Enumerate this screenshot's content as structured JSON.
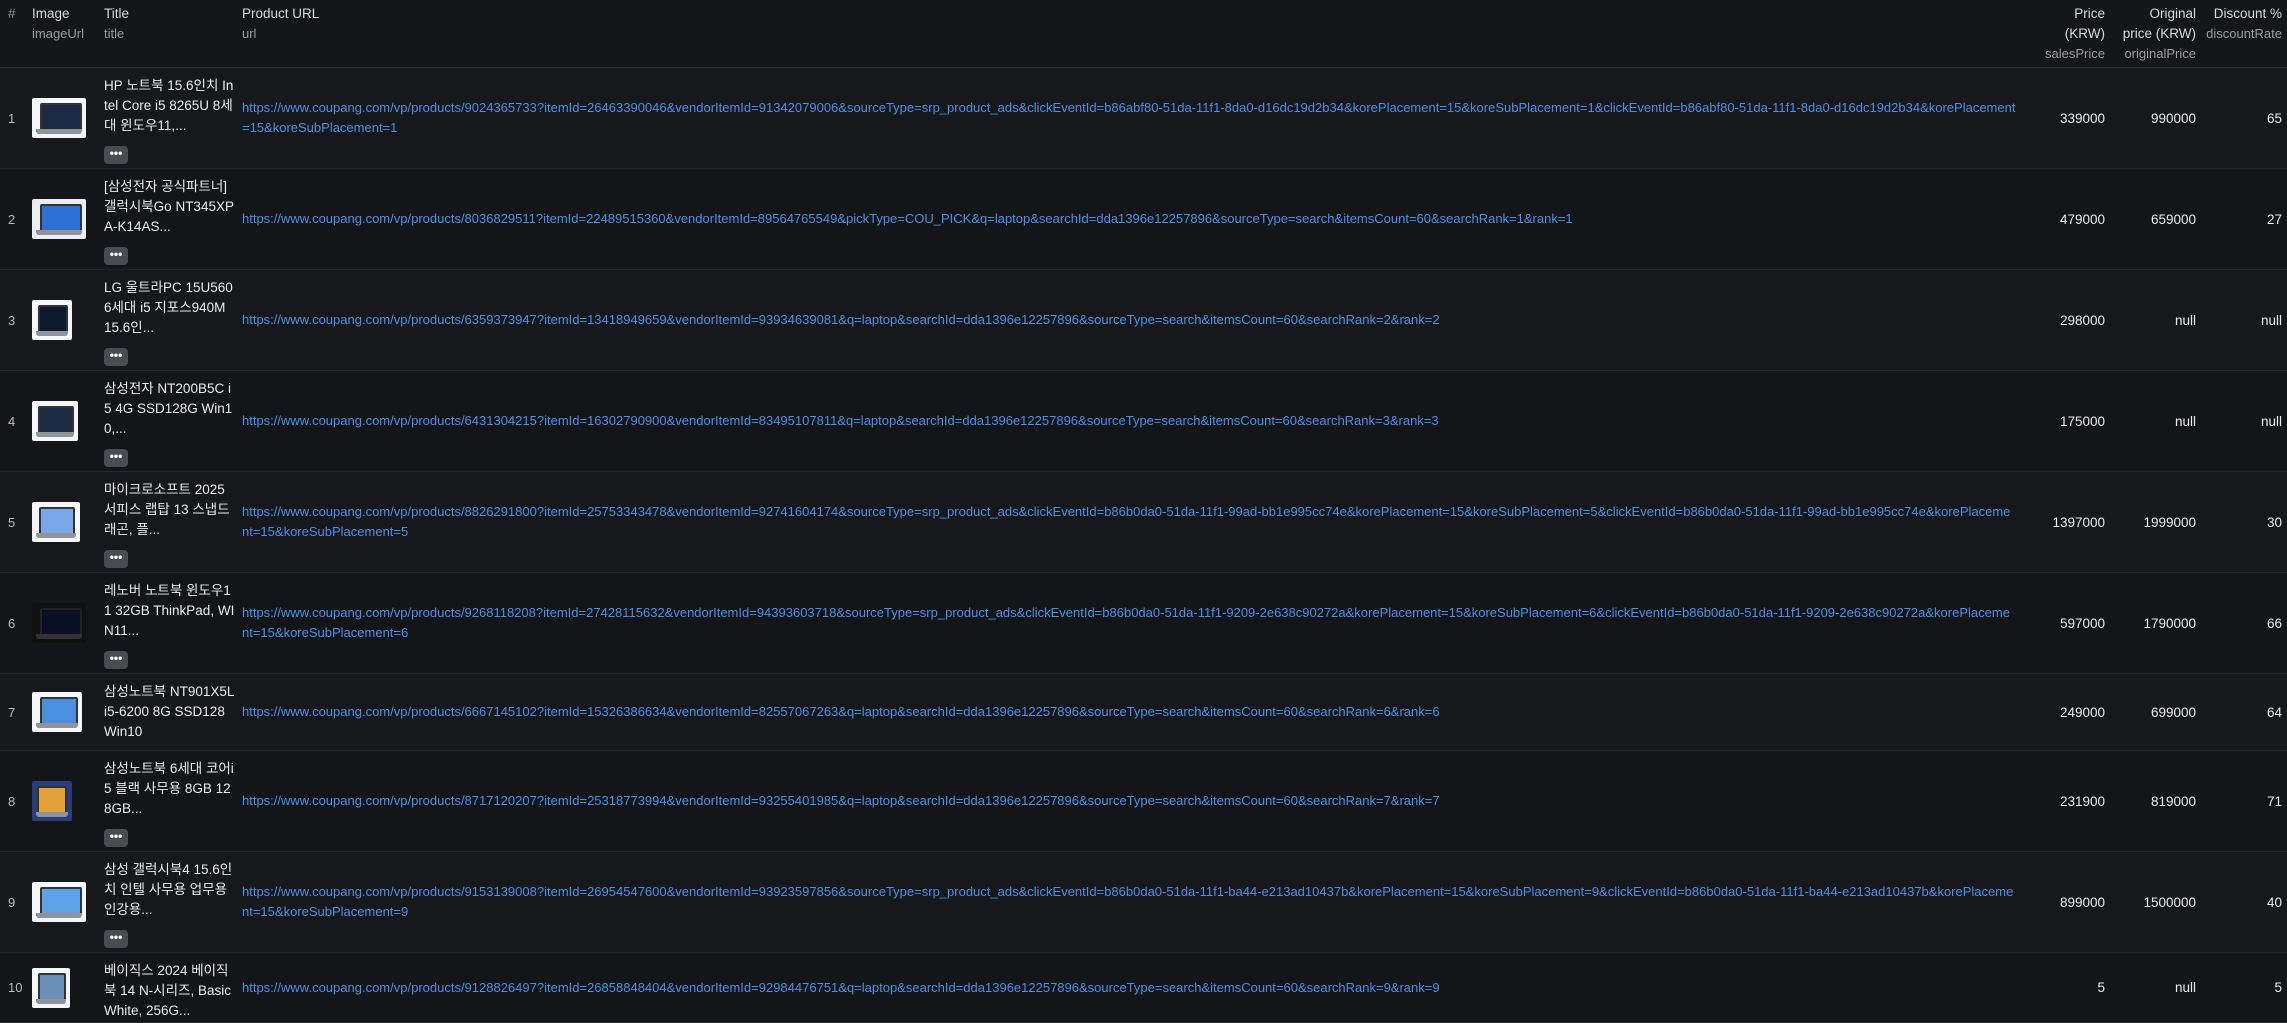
{
  "columns": {
    "num": "#",
    "image": {
      "label": "Image",
      "field": "imageUrl"
    },
    "title": {
      "label": "Title",
      "field": "title"
    },
    "url": {
      "label": "Product URL",
      "field": "url"
    },
    "price": {
      "label1": "Price",
      "label2": "(KRW)",
      "field": "salesPrice"
    },
    "orig": {
      "label1": "Original",
      "label2": "price (KRW)",
      "field": "originalPrice"
    },
    "disc": {
      "label1": "Discount %",
      "field": "discountRate"
    }
  },
  "more_label": "•••",
  "rows": [
    {
      "num": "1",
      "title": "HP 노트북 15.6인치 Intel Core i5 8265U 8세대 윈도우11,...",
      "url": "https://www.coupang.com/vp/products/9024365733?itemId=26463390046&vendorItemId=91342079006&sourceType=srp_product_ads&clickEventId=b86abf80-51da-11f1-8da0-d16dc19d2b34&korePlacement=15&koreSubPlacement=1&clickEventId=b86abf80-51da-11f1-8da0-d16dc19d2b34&korePlacement=15&koreSubPlacement=1",
      "price": "339000",
      "orig": "990000",
      "disc": "65"
    },
    {
      "num": "2",
      "title": "[삼성전자 공식파트너] 갤럭시북Go NT345XPA-K14AS...",
      "url": "https://www.coupang.com/vp/products/8036829511?itemId=22489515360&vendorItemId=89564765549&pickType=COU_PICK&q=laptop&searchId=dda1396e12257896&sourceType=search&itemsCount=60&searchRank=1&rank=1",
      "price": "479000",
      "orig": "659000",
      "disc": "27"
    },
    {
      "num": "3",
      "title": "LG 울트라PC 15U560 6세대 i5 지포스940M 15.6인...",
      "url": "https://www.coupang.com/vp/products/6359373947?itemId=13418949659&vendorItemId=93934639081&q=laptop&searchId=dda1396e12257896&sourceType=search&itemsCount=60&searchRank=2&rank=2",
      "price": "298000",
      "orig": "null",
      "disc": "null"
    },
    {
      "num": "4",
      "title": "삼성전자 NT200B5C i5 4G SSD128G Win10,...",
      "url": "https://www.coupang.com/vp/products/6431304215?itemId=16302790900&vendorItemId=83495107811&q=laptop&searchId=dda1396e12257896&sourceType=search&itemsCount=60&searchRank=3&rank=3",
      "price": "175000",
      "orig": "null",
      "disc": "null"
    },
    {
      "num": "5",
      "title": "마이크로소프트 2025 서피스 랩탑 13 스냅드래곤, 플...",
      "url": "https://www.coupang.com/vp/products/8826291800?itemId=25753343478&vendorItemId=92741604174&sourceType=srp_product_ads&clickEventId=b86b0da0-51da-11f1-99ad-bb1e995cc74e&korePlacement=15&koreSubPlacement=5&clickEventId=b86b0da0-51da-11f1-99ad-bb1e995cc74e&korePlacement=15&koreSubPlacement=5",
      "price": "1397000",
      "orig": "1999000",
      "disc": "30"
    },
    {
      "num": "6",
      "title": "레노버 노트북 윈도우11 32GB ThinkPad, WIN11...",
      "url": "https://www.coupang.com/vp/products/9268118208?itemId=27428115632&vendorItemId=94393603718&sourceType=srp_product_ads&clickEventId=b86b0da0-51da-11f1-9209-2e638c90272a&korePlacement=15&koreSubPlacement=6&clickEventId=b86b0da0-51da-11f1-9209-2e638c90272a&korePlacement=15&koreSubPlacement=6",
      "price": "597000",
      "orig": "1790000",
      "disc": "66"
    },
    {
      "num": "7",
      "title": "삼성노트북 NT901X5L i5-6200 8G SSD128 Win10",
      "url": "https://www.coupang.com/vp/products/6667145102?itemId=15326386634&vendorItemId=82557067263&q=laptop&searchId=dda1396e12257896&sourceType=search&itemsCount=60&searchRank=6&rank=6",
      "price": "249000",
      "orig": "699000",
      "disc": "64"
    },
    {
      "num": "8",
      "title": "삼성노트북 6세대 코어i5 블랙 사무용 8GB 128GB...",
      "url": "https://www.coupang.com/vp/products/8717120207?itemId=25318773994&vendorItemId=93255401985&q=laptop&searchId=dda1396e12257896&sourceType=search&itemsCount=60&searchRank=7&rank=7",
      "price": "231900",
      "orig": "819000",
      "disc": "71"
    },
    {
      "num": "9",
      "title": "삼성 갤럭시북4 15.6인치 인텔 사무용 업무용 인강용...",
      "url": "https://www.coupang.com/vp/products/9153139008?itemId=26954547600&vendorItemId=93923597856&sourceType=srp_product_ads&clickEventId=b86b0da0-51da-11f1-ba44-e213ad10437b&korePlacement=15&koreSubPlacement=9&clickEventId=b86b0da0-51da-11f1-ba44-e213ad10437b&korePlacement=15&koreSubPlacement=9",
      "price": "899000",
      "orig": "1500000",
      "disc": "40"
    },
    {
      "num": "10",
      "title": "베이직스 2024 베이직북 14 N-시리즈, BasicWhite, 256G...",
      "url": "https://www.coupang.com/vp/products/9128826497?itemId=26858848404&vendorItemId=92984476751&q=laptop&searchId=dda1396e12257896&sourceType=search&itemsCount=60&searchRank=9&rank=9",
      "price": "5",
      "orig": "null",
      "disc": "5"
    }
  ]
}
